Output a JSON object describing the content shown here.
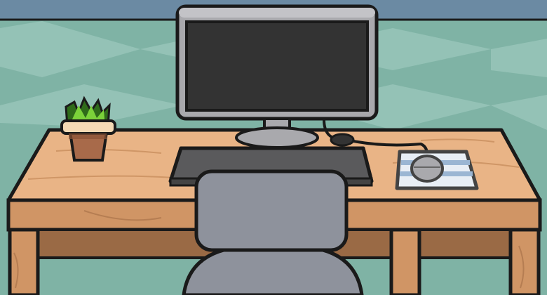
{
  "scene": {
    "description_colors": {
      "wall": "#7fb3a5",
      "wall_pattern": "#94c2b6",
      "ceiling_strip": "#6b8aa3",
      "desk_top": "#e9b486",
      "desk_front": "#d09565",
      "desk_inner": "#9a6a45",
      "monitor_frame": "#a9a9ad",
      "monitor_screen": "#333333",
      "keyboard": "#5a5a5c",
      "chair": "#8e929c",
      "mousepad_stripe": "#9bb6d3",
      "plant_leaves": "#7bd23a",
      "pot": "#a86a4a"
    },
    "objects": [
      "monitor",
      "keyboard",
      "mouse",
      "mousepad",
      "plant-pot",
      "office-chair",
      "desk"
    ]
  }
}
